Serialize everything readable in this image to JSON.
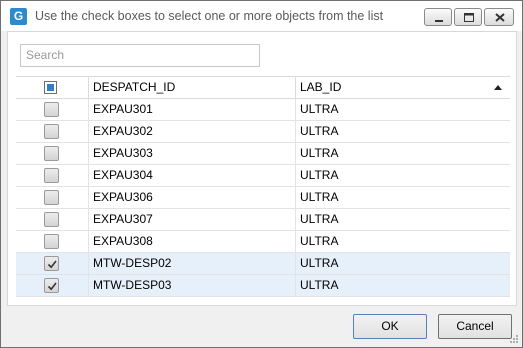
{
  "window": {
    "title": "Use the check boxes to select one or more objects from the list",
    "app_icon_letter": "G"
  },
  "search": {
    "placeholder": "Search",
    "value": ""
  },
  "table": {
    "columns": [
      "DESPATCH_ID",
      "LAB_ID"
    ],
    "sort": {
      "column": "LAB_ID",
      "direction": "ascending"
    },
    "header_checkbox": "indeterminate",
    "rows": [
      {
        "checked": false,
        "despatch_id": "EXPAU301",
        "lab_id": "ULTRA"
      },
      {
        "checked": false,
        "despatch_id": "EXPAU302",
        "lab_id": "ULTRA"
      },
      {
        "checked": false,
        "despatch_id": "EXPAU303",
        "lab_id": "ULTRA"
      },
      {
        "checked": false,
        "despatch_id": "EXPAU304",
        "lab_id": "ULTRA"
      },
      {
        "checked": false,
        "despatch_id": "EXPAU306",
        "lab_id": "ULTRA"
      },
      {
        "checked": false,
        "despatch_id": "EXPAU307",
        "lab_id": "ULTRA"
      },
      {
        "checked": false,
        "despatch_id": "EXPAU308",
        "lab_id": "ULTRA"
      },
      {
        "checked": true,
        "despatch_id": "MTW-DESP02",
        "lab_id": "ULTRA"
      },
      {
        "checked": true,
        "despatch_id": "MTW-DESP03",
        "lab_id": "ULTRA"
      }
    ]
  },
  "buttons": {
    "ok": "OK",
    "cancel": "Cancel"
  },
  "colors": {
    "accent": "#2a8bd0",
    "selected_row": "#e6f0fa",
    "checkbox_indeterminate": "#2f7fcc"
  }
}
